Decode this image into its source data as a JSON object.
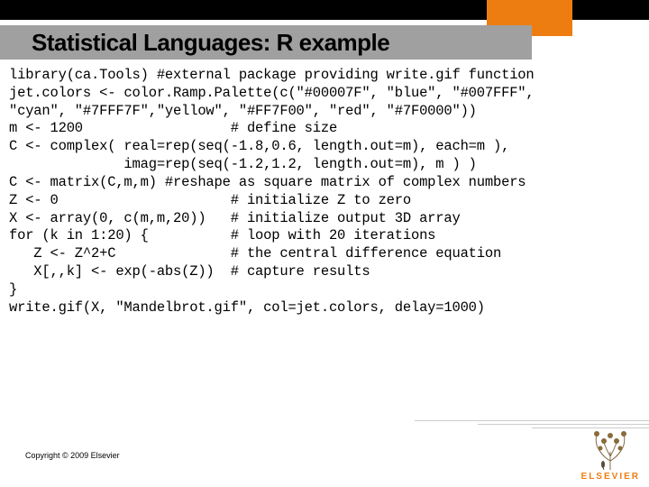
{
  "header": {
    "title": "Statistical Languages: R example"
  },
  "code": {
    "lines": [
      "library(ca.Tools) #external package providing write.gif function",
      "jet.colors <- color.Ramp.Palette(c(\"#00007F\", \"blue\", \"#007FFF\",",
      "\"cyan\", \"#7FFF7F\",\"yellow\", \"#FF7F00\", \"red\", \"#7F0000\"))",
      "m <- 1200                  # define size",
      "C <- complex( real=rep(seq(-1.8,0.6, length.out=m), each=m ),",
      "              imag=rep(seq(-1.2,1.2, length.out=m), m ) )",
      "C <- matrix(C,m,m) #reshape as square matrix of complex numbers",
      "Z <- 0                     # initialize Z to zero",
      "X <- array(0, c(m,m,20))   # initialize output 3D array",
      "for (k in 1:20) {          # loop with 20 iterations",
      "   Z <- Z^2+C              # the central difference equation",
      "   X[,,k] <- exp(-abs(Z))  # capture results",
      "}",
      "write.gif(X, \"Mandelbrot.gif\", col=jet.colors, delay=1000)"
    ]
  },
  "footer": {
    "copyright": "Copyright © 2009 Elsevier"
  },
  "logo": {
    "text": "ELSEVIER"
  }
}
